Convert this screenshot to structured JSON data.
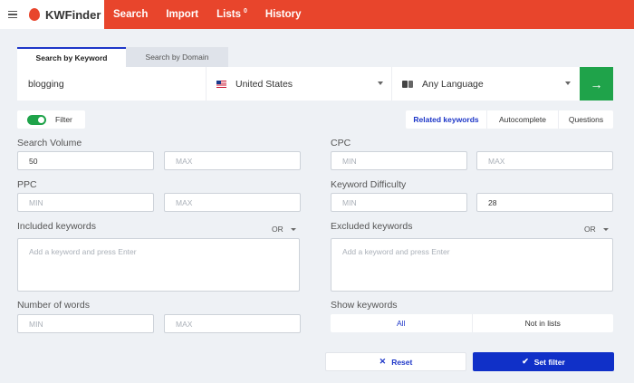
{
  "app": {
    "name": "KWFinder"
  },
  "nav": {
    "items": [
      {
        "label": "Search"
      },
      {
        "label": "Import"
      },
      {
        "label": "Lists",
        "badge": "0"
      },
      {
        "label": "History"
      }
    ]
  },
  "tabs": {
    "keyword": "Search by Keyword",
    "domain": "Search by Domain"
  },
  "search": {
    "keyword_value": "blogging",
    "country": "United States",
    "language": "Any Language",
    "go_icon": "arrow-right-icon"
  },
  "filter": {
    "label": "Filter",
    "enabled": true
  },
  "modes": [
    "Related keywords",
    "Autocomplete",
    "Questions"
  ],
  "form": {
    "search_volume": {
      "label": "Search Volume",
      "min": "50",
      "max_placeholder": "MAX"
    },
    "cpc": {
      "label": "CPC",
      "min_placeholder": "MIN",
      "max_placeholder": "MAX"
    },
    "ppc": {
      "label": "PPC",
      "min_placeholder": "MIN",
      "max_placeholder": "MAX"
    },
    "keyword_difficulty": {
      "label": "Keyword Difficulty",
      "min_placeholder": "MIN",
      "max": "28"
    },
    "included": {
      "label": "Included keywords",
      "operator": "OR",
      "placeholder": "Add a keyword and press Enter"
    },
    "excluded": {
      "label": "Excluded keywords",
      "operator": "OR",
      "placeholder": "Add a keyword and press Enter"
    },
    "number_of_words": {
      "label": "Number of words",
      "min_placeholder": "MIN",
      "max_placeholder": "MAX"
    },
    "show_keywords": {
      "label": "Show keywords",
      "options": [
        "All",
        "Not in lists"
      ],
      "selected": "All"
    }
  },
  "buttons": {
    "reset": "Reset",
    "set_filter": "Set filter"
  },
  "colors": {
    "brand": "#e8452c",
    "primary": "#1030c8",
    "go": "#1fa34a"
  }
}
